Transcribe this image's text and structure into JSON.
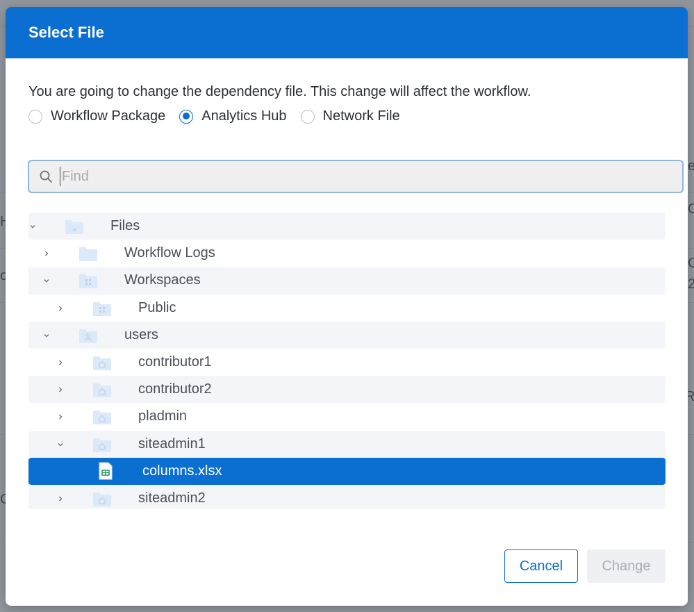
{
  "background": {
    "fragments": [
      "e",
      "C",
      "H",
      "C",
      "o",
      "2",
      "Ro",
      "C"
    ]
  },
  "dialog": {
    "title": "Select File",
    "message": "You are going to change the dependency file. This change will affect the workflow.",
    "source_options": [
      {
        "label": "Workflow Package",
        "checked": false
      },
      {
        "label": "Analytics Hub",
        "checked": true
      },
      {
        "label": "Network File",
        "checked": false
      }
    ],
    "search": {
      "placeholder": "Find",
      "value": ""
    },
    "tree": [
      {
        "label": "Files",
        "expanded": true,
        "icon": "home-folder-icon"
      },
      {
        "label": "Workflow Logs",
        "expanded": false,
        "icon": "folder-icon"
      },
      {
        "label": "Workspaces",
        "expanded": true,
        "icon": "workspace-folder-icon"
      },
      {
        "label": "Public",
        "expanded": false,
        "icon": "workspace-folder-icon"
      },
      {
        "label": "users",
        "expanded": true,
        "icon": "users-folder-icon"
      },
      {
        "label": "contributor1",
        "expanded": false,
        "icon": "user-home-folder-icon"
      },
      {
        "label": "contributor2",
        "expanded": false,
        "icon": "user-home-folder-icon"
      },
      {
        "label": "pladmin",
        "expanded": false,
        "icon": "user-home-folder-icon"
      },
      {
        "label": "siteadmin1",
        "expanded": true,
        "icon": "user-home-folder-icon"
      },
      {
        "label": "columns.xlsx",
        "selected": true,
        "icon": "spreadsheet-file-icon"
      },
      {
        "label": "siteadmin2",
        "expanded": false,
        "icon": "user-home-folder-icon"
      }
    ],
    "buttons": {
      "cancel": "Cancel",
      "change": "Change",
      "change_enabled": false
    }
  },
  "colors": {
    "accent": "#0b6fd1",
    "selected_row": "#0b6fd1",
    "folder": "#dbe9f8",
    "spreadsheet": "#1e8e5a"
  }
}
